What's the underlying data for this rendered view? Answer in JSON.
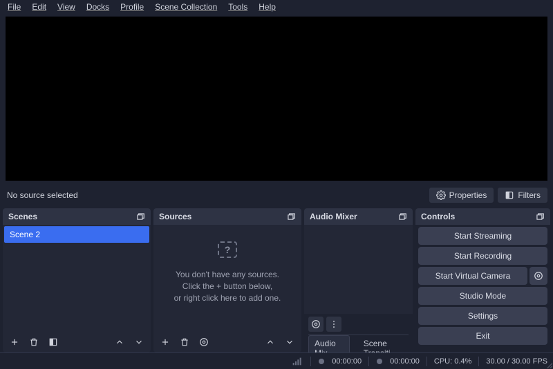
{
  "menu": [
    "File",
    "Edit",
    "View",
    "Docks",
    "Profile",
    "Scene Collection",
    "Tools",
    "Help"
  ],
  "toolbar": {
    "no_source": "No source selected",
    "properties": "Properties",
    "filters": "Filters"
  },
  "scenes": {
    "title": "Scenes",
    "items": [
      "Scene 2"
    ]
  },
  "sources": {
    "title": "Sources",
    "empty1": "You don't have any sources.",
    "empty2": "Click the + button below,",
    "empty3": "or right click here to add one."
  },
  "mixer": {
    "title": "Audio Mixer",
    "tab1": "Audio Mix...",
    "tab2": "Scene Transiti..."
  },
  "controls": {
    "title": "Controls",
    "start_streaming": "Start Streaming",
    "start_recording": "Start Recording",
    "start_virtual_camera": "Start Virtual Camera",
    "studio_mode": "Studio Mode",
    "settings": "Settings",
    "exit": "Exit"
  },
  "status": {
    "live_time": "00:00:00",
    "rec_time": "00:00:00",
    "cpu": "CPU: 0.4%",
    "fps": "30.00 / 30.00 FPS"
  }
}
